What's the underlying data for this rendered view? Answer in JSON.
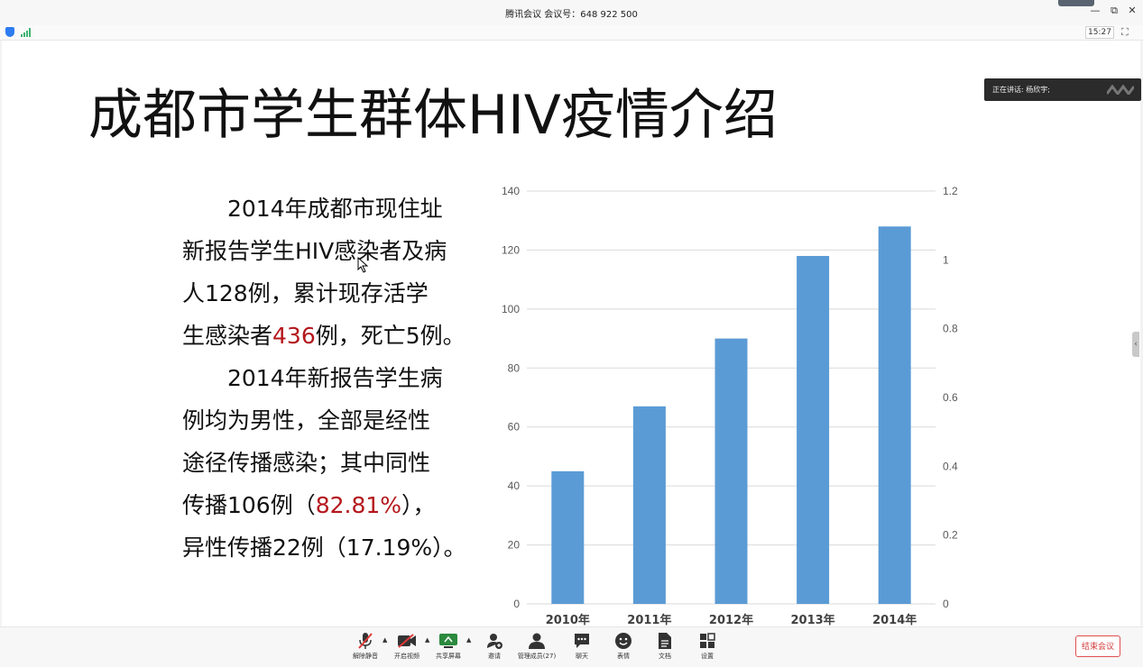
{
  "window": {
    "title": "腾讯会议 会议号：648 922 500",
    "minimize": "—",
    "restore": "⧉",
    "close": "✕"
  },
  "status": {
    "time": "15:27",
    "fullscreen_icon": "fullscreen-icon"
  },
  "speaker": {
    "label": "正在讲话: 杨欣宇;"
  },
  "slide": {
    "title": "成都市学生群体HIV疫情介绍",
    "lines": [
      {
        "pre": "　　2014年成都市现住址",
        "hl": "",
        "post": ""
      },
      {
        "pre": "新报告学生HIV感染者及病",
        "hl": "",
        "post": ""
      },
      {
        "pre": "人128例，累计现存活学",
        "hl": "",
        "post": ""
      },
      {
        "pre": "生感染者",
        "hl": "436",
        "post": "例，死亡5例。"
      },
      {
        "pre": "　　2014年新报告学生病",
        "hl": "",
        "post": ""
      },
      {
        "pre": "例均为男性，全部是经性",
        "hl": "",
        "post": ""
      },
      {
        "pre": "途径传播感染；其中同性",
        "hl": "",
        "post": ""
      },
      {
        "pre": "传播106例（",
        "hl": "82.81%",
        "post": "），"
      },
      {
        "pre": "异性传播22例（17.19%）。",
        "hl": "",
        "post": ""
      }
    ],
    "highlight_color": "#b4161b"
  },
  "chart_data": {
    "type": "bar",
    "categories": [
      "2010年",
      "2011年",
      "2012年",
      "2013年",
      "2014年"
    ],
    "values": [
      45,
      67,
      90,
      118,
      128
    ],
    "ylim": [
      0,
      140
    ],
    "yticks": [
      0,
      20,
      40,
      60,
      80,
      100,
      120,
      140
    ],
    "y2lim": [
      0,
      1.2
    ],
    "y2ticks": [
      "0",
      "0.2",
      "0.4",
      "0.6",
      "0.8",
      "1",
      "1.2"
    ],
    "grid": true,
    "bar_color": "#5b9bd5"
  },
  "toolbar": {
    "items": [
      {
        "label": "解除静音",
        "icon": "muted-mic-icon"
      },
      {
        "label": "开启视频",
        "icon": "video-off-icon"
      },
      {
        "label": "共享屏幕",
        "icon": "share-screen-icon"
      },
      {
        "label": "邀请",
        "icon": "invite-icon"
      },
      {
        "label": "管理成员(27)",
        "icon": "members-icon"
      },
      {
        "label": "聊天",
        "icon": "chat-icon"
      },
      {
        "label": "表情",
        "icon": "emoji-icon"
      },
      {
        "label": "文档",
        "icon": "document-icon"
      },
      {
        "label": "设置",
        "icon": "settings-icon"
      }
    ],
    "end_meeting": "结束会议"
  }
}
